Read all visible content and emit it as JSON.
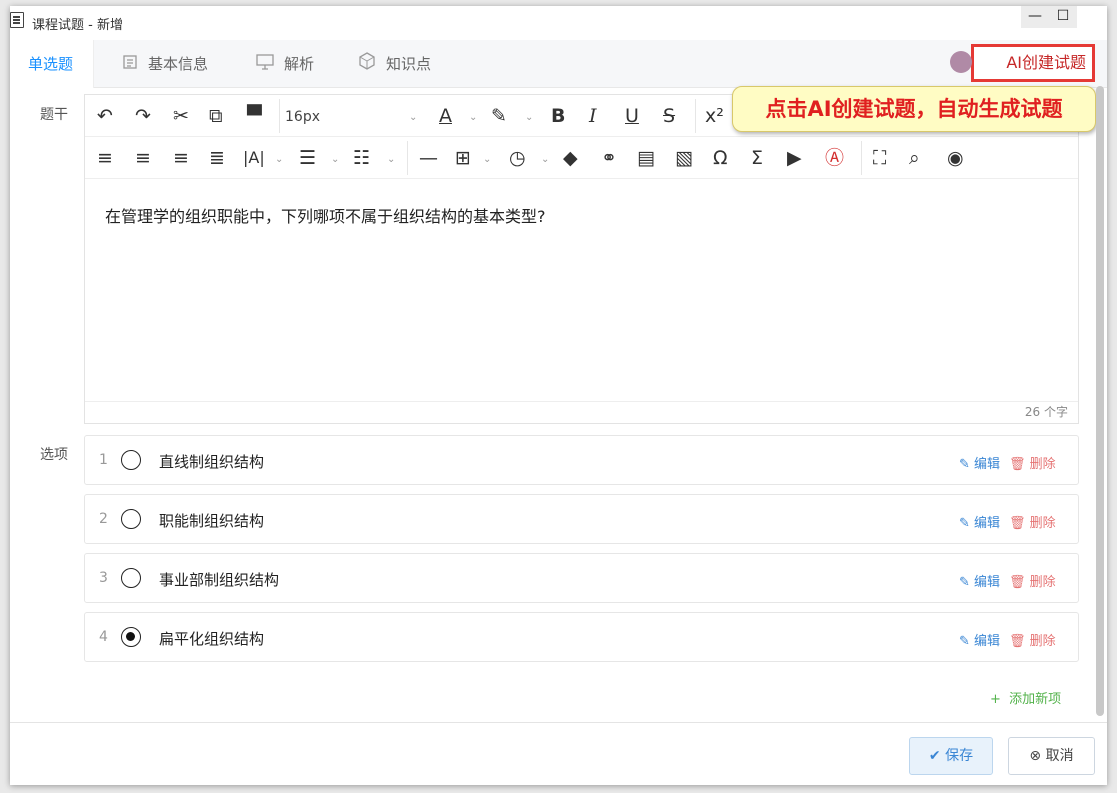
{
  "window": {
    "title": "课程试题 - 新增",
    "minimize": "—",
    "maximize": "☐",
    "close": "✕"
  },
  "tabs": [
    {
      "label": "单选题"
    },
    {
      "label": "基本信息"
    },
    {
      "label": "解析"
    },
    {
      "label": "知识点"
    }
  ],
  "ai_button": "AI创建试题",
  "callout": "点击AI创建试题，自动生成试题",
  "labels": {
    "stem": "题干",
    "options": "选项"
  },
  "toolbar": {
    "font_size": "16px"
  },
  "editor": {
    "content": "在管理学的组织职能中，下列哪项不属于组织结构的基本类型?",
    "word_count": "26 个字"
  },
  "options": [
    {
      "num": "1",
      "text": "直线制组织结构",
      "checked": false
    },
    {
      "num": "2",
      "text": "职能制组织结构",
      "checked": false
    },
    {
      "num": "3",
      "text": "事业部制组织结构",
      "checked": false
    },
    {
      "num": "4",
      "text": "扁平化组织结构",
      "checked": true
    }
  ],
  "option_actions": {
    "edit": "编辑",
    "delete": "删除"
  },
  "add_new": "添加新项",
  "footer": {
    "save": "保存",
    "cancel": "取消"
  }
}
